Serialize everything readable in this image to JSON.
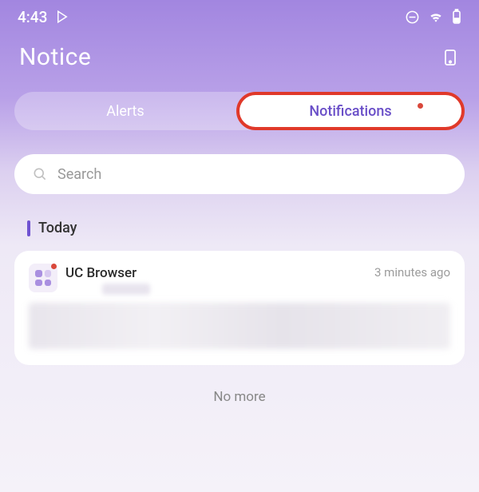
{
  "statusbar": {
    "time": "4:43"
  },
  "header": {
    "title": "Notice"
  },
  "tabs": {
    "alerts": "Alerts",
    "notifications": "Notifications"
  },
  "search": {
    "placeholder": "Search"
  },
  "section": {
    "label": "Today"
  },
  "card": {
    "app": "UC Browser",
    "time": "3 minutes ago"
  },
  "footer": {
    "no_more": "No more"
  }
}
